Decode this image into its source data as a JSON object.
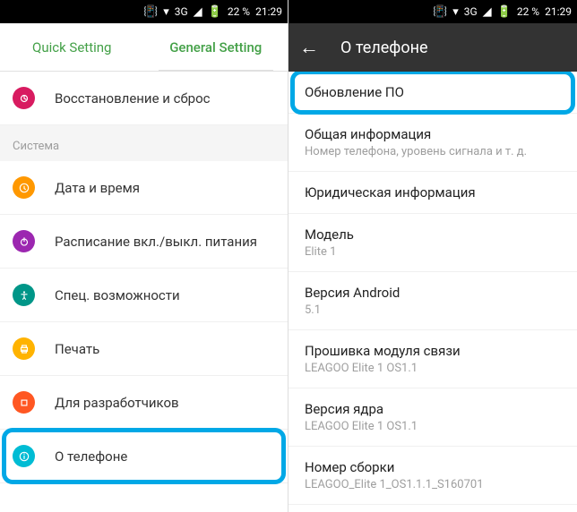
{
  "status": {
    "battery": "22 %",
    "time": "21:29",
    "network": "3G"
  },
  "left": {
    "tabs": {
      "quick": "Quick Setting",
      "general": "General Setting"
    },
    "restore": "Восстановление и сброс",
    "system_header": "Система",
    "date": "Дата и время",
    "power": "Расписание вкл./выкл. питания",
    "access": "Спец. возможности",
    "print": "Печать",
    "dev": "Для разработчиков",
    "about": "О телефоне"
  },
  "right": {
    "title": "О телефоне",
    "items": [
      {
        "title": "Обновление ПО",
        "sub": ""
      },
      {
        "title": "Общая информация",
        "sub": "Номер телефона, уровень сигнала и т. д."
      },
      {
        "title": "Юридическая информация",
        "sub": ""
      },
      {
        "title": "Модель",
        "sub": "Elite 1"
      },
      {
        "title": "Версия Android",
        "sub": "5.1"
      },
      {
        "title": "Прошивка модуля связи",
        "sub": "LEAGOO Elite 1 OS1.1"
      },
      {
        "title": "Версия ядра",
        "sub": "LEAGOO Elite 1 OS1.1"
      },
      {
        "title": "Номер сборки",
        "sub": "LEAGOO_Elite 1_OS1.1.1_S160701"
      }
    ]
  }
}
